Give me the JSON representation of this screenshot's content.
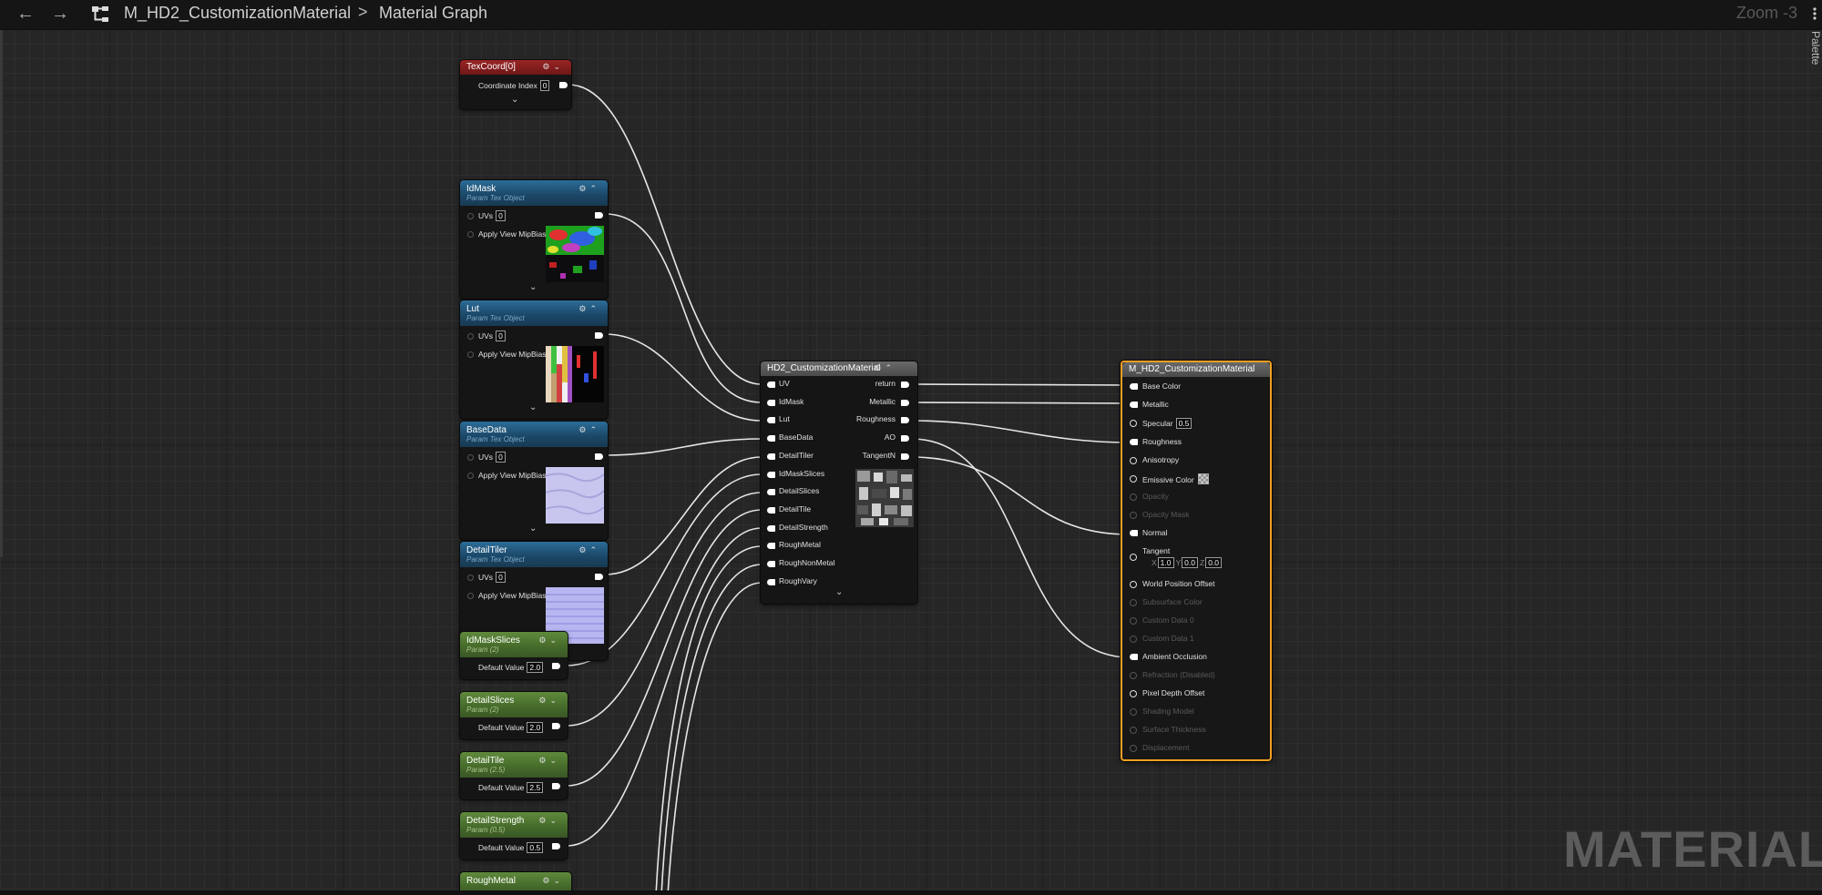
{
  "toolbar": {
    "back_icon": "arrow-left-icon",
    "forward_icon": "arrow-right-icon",
    "breadcrumb_root": "M_HD2_CustomizationMaterial",
    "breadcrumb_separator": ">",
    "breadcrumb_leaf": "Material Graph",
    "zoom": "Zoom -3",
    "palette": "Palette"
  },
  "watermark": "MATERIAL",
  "colors": {
    "param_tex_header": "#1b4666",
    "scalar_param_header": "#456a2a",
    "texcoord_header": "#6e1717",
    "function_header": "#4a4a4a",
    "selected_border": "#f0a020",
    "wire": "#e6e6e6"
  },
  "nodes": {
    "texcoord": {
      "title": "TexCoord[0]",
      "row_label": "Coordinate Index",
      "row_value": "0"
    },
    "idmask": {
      "title": "IdMask",
      "subtitle": "Param Tex Object",
      "uvs_label": "UVs",
      "uvs_value": "0",
      "mip_label": "Apply View MipBias"
    },
    "lut": {
      "title": "Lut",
      "subtitle": "Param Tex Object",
      "uvs_label": "UVs",
      "uvs_value": "0",
      "mip_label": "Apply View MipBias"
    },
    "basedata": {
      "title": "BaseData",
      "subtitle": "Param Tex Object",
      "uvs_label": "UVs",
      "uvs_value": "0",
      "mip_label": "Apply View MipBias"
    },
    "detailtiler": {
      "title": "DetailTiler",
      "subtitle": "Param Tex Object",
      "uvs_label": "UVs",
      "uvs_value": "0",
      "mip_label": "Apply View MipBias"
    },
    "idmaskslices": {
      "title": "IdMaskSlices",
      "subtitle": "Param (2)",
      "row_label": "Default Value",
      "row_value": "2.0"
    },
    "detailslices": {
      "title": "DetailSlices",
      "subtitle": "Param (2)",
      "row_label": "Default Value",
      "row_value": "2.0"
    },
    "detailtile": {
      "title": "DetailTile",
      "subtitle": "Param (2.5)",
      "row_label": "Default Value",
      "row_value": "2.5"
    },
    "detailstrength": {
      "title": "DetailStrength",
      "subtitle": "Param (0.5)",
      "row_label": "Default Value",
      "row_value": "0.5"
    },
    "roughmetal": {
      "title": "RoughMetal"
    },
    "function": {
      "title": "HD2_CustomizationMaterial",
      "inputs": [
        "UV",
        "IdMask",
        "Lut",
        "BaseData",
        "DetailTiler",
        "IdMaskSlices",
        "DetailSlices",
        "DetailTile",
        "DetailStrength",
        "RoughMetal",
        "RoughNonMetal",
        "RoughVary"
      ],
      "outputs": [
        "return",
        "Metallic",
        "Roughness",
        "AO",
        "TangentN"
      ]
    },
    "result": {
      "title": "M_HD2_CustomizationMaterial",
      "pins": [
        {
          "label": "Base Color",
          "enabled": true
        },
        {
          "label": "Metallic",
          "enabled": true
        },
        {
          "label": "Specular",
          "enabled": true,
          "value": "0.5"
        },
        {
          "label": "Roughness",
          "enabled": true
        },
        {
          "label": "Anisotropy",
          "enabled": true
        },
        {
          "label": "Emissive Color",
          "enabled": true
        },
        {
          "label": "Opacity",
          "enabled": false
        },
        {
          "label": "Opacity Mask",
          "enabled": false
        },
        {
          "label": "Normal",
          "enabled": true
        },
        {
          "label": "Tangent",
          "enabled": true
        },
        {
          "label": "World Position Offset",
          "enabled": true
        },
        {
          "label": "Subsurface Color",
          "enabled": false
        },
        {
          "label": "Custom Data 0",
          "enabled": false
        },
        {
          "label": "Custom Data 1",
          "enabled": false
        },
        {
          "label": "Ambient Occlusion",
          "enabled": true
        },
        {
          "label": "Refraction (Disabled)",
          "enabled": false
        },
        {
          "label": "Pixel Depth Offset",
          "enabled": true
        },
        {
          "label": "Shading Model",
          "enabled": false
        },
        {
          "label": "Surface Thickness",
          "enabled": false
        },
        {
          "label": "Displacement",
          "enabled": false
        }
      ],
      "tangent": {
        "x_label": "X",
        "x": "1.0",
        "y_label": "Y",
        "y": "0.0",
        "z_label": "Z",
        "z": "0.0"
      }
    }
  }
}
